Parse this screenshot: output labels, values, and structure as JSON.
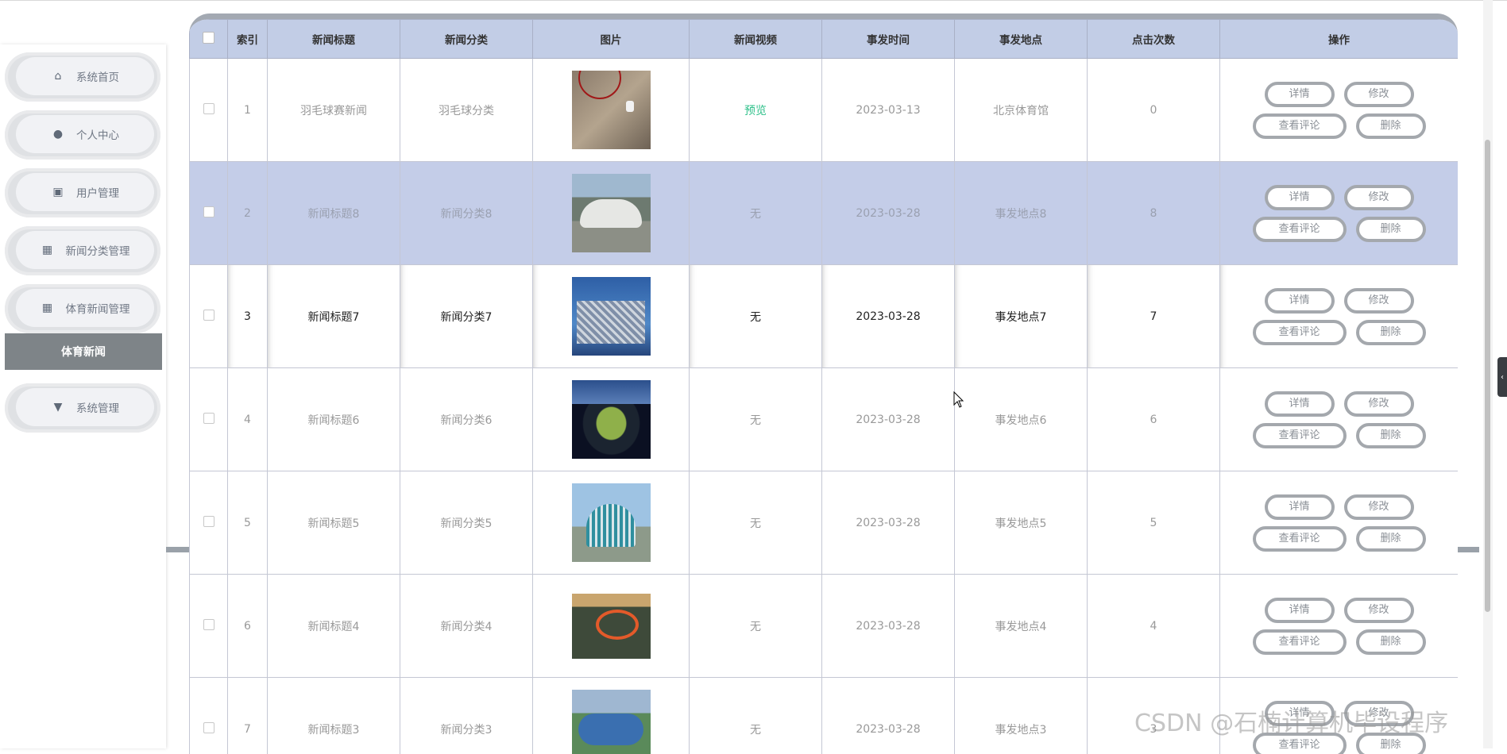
{
  "sidebar": {
    "items": [
      {
        "label": "系统首页",
        "icon": "home-icon"
      },
      {
        "label": "个人中心",
        "icon": "user-icon"
      },
      {
        "label": "用户管理",
        "icon": "chart-icon"
      },
      {
        "label": "新闻分类管理",
        "icon": "grid-icon"
      },
      {
        "label": "体育新闻管理",
        "icon": "grid-icon"
      },
      {
        "label": "系统管理",
        "icon": "settings-icon"
      }
    ],
    "submenu": {
      "label": "体育新闻"
    }
  },
  "table": {
    "headers": {
      "index": "索引",
      "title": "新闻标题",
      "category": "新闻分类",
      "image": "图片",
      "video": "新闻视频",
      "date": "事发时间",
      "location": "事发地点",
      "clicks": "点击次数",
      "actions": "操作"
    },
    "rows": [
      {
        "index": "1",
        "title": "羽毛球赛新闻",
        "category": "羽毛球分类",
        "video": "预览",
        "date": "2023-03-13",
        "location": "北京体育馆",
        "clicks": "0"
      },
      {
        "index": "2",
        "title": "新闻标题8",
        "category": "新闻分类8",
        "video": "无",
        "date": "2023-03-28",
        "location": "事发地点8",
        "clicks": "8"
      },
      {
        "index": "3",
        "title": "新闻标题7",
        "category": "新闻分类7",
        "video": "无",
        "date": "2023-03-28",
        "location": "事发地点7",
        "clicks": "7"
      },
      {
        "index": "4",
        "title": "新闻标题6",
        "category": "新闻分类6",
        "video": "无",
        "date": "2023-03-28",
        "location": "事发地点6",
        "clicks": "6"
      },
      {
        "index": "5",
        "title": "新闻标题5",
        "category": "新闻分类5",
        "video": "无",
        "date": "2023-03-28",
        "location": "事发地点5",
        "clicks": "5"
      },
      {
        "index": "6",
        "title": "新闻标题4",
        "category": "新闻分类4",
        "video": "无",
        "date": "2023-03-28",
        "location": "事发地点4",
        "clicks": "4"
      },
      {
        "index": "7",
        "title": "新闻标题3",
        "category": "新闻分类3",
        "video": "无",
        "date": "2023-03-28",
        "location": "事发地点3",
        "clicks": "3"
      }
    ],
    "actions": {
      "detail": "详情",
      "edit": "修改",
      "comments": "查看评论",
      "delete": "删除"
    }
  },
  "watermark": "CSDN @石楠计算机毕设程序",
  "colors": {
    "header_bg": "#c2cde6",
    "selected_row_bg": "#c4cde8",
    "submenu_bg": "#7e8488",
    "video_link": "#2ec08a"
  }
}
